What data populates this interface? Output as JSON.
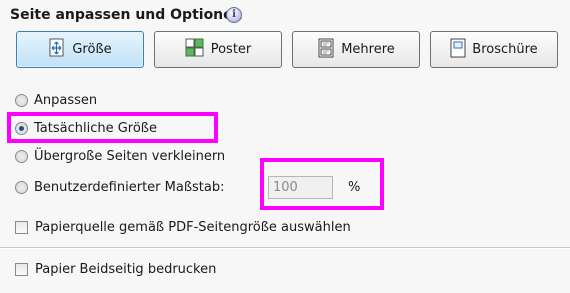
{
  "section": {
    "title": "Seite anpassen und Optionen",
    "info_icon_glyph": "i"
  },
  "buttons": [
    {
      "label": "Größe",
      "icon": "size-icon",
      "active": true
    },
    {
      "label": "Poster",
      "icon": "poster-icon",
      "active": false
    },
    {
      "label": "Mehrere",
      "icon": "multiple-pages-icon",
      "active": false
    },
    {
      "label": "Broschüre",
      "icon": "booklet-icon",
      "active": false
    }
  ],
  "options": {
    "fit": "Anpassen",
    "actual_size": "Tatsächliche Größe",
    "shrink_oversized": "Übergroße Seiten verkleinern",
    "custom_scale": "Benutzerdefinierter Maßstab:",
    "scale_value": "100",
    "scale_unit": "%",
    "selected": "actual_size"
  },
  "checkboxes": {
    "paper_source": "Papierquelle gemäß PDF-Seitengröße auswählen",
    "duplex": "Papier Beidseitig bedrucken"
  },
  "colors": {
    "highlight": "#ff00ff",
    "active_button": "#bfe1f6"
  }
}
